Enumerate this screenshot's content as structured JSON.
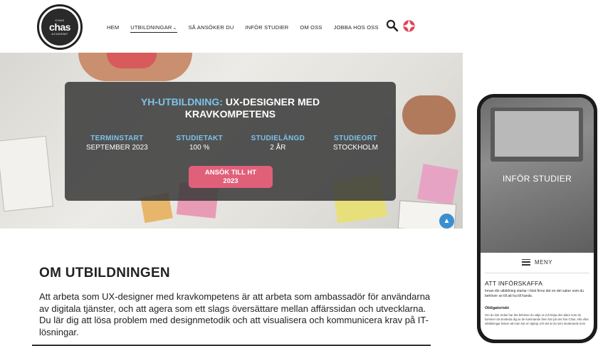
{
  "header": {
    "logo": {
      "small_top": "CHAS",
      "name": "chas",
      "small_bottom": "ACADEMY"
    },
    "nav": [
      {
        "label": "HEM"
      },
      {
        "label": "UTBILDNINGAR",
        "active": true
      },
      {
        "label": "SÅ ANSÖKER DU"
      },
      {
        "label": "INFÖR STUDIER"
      },
      {
        "label": "OM OSS"
      },
      {
        "label": "JOBBA HOS OSS"
      }
    ],
    "search_icon": "search-icon",
    "help_icon": "lifebuoy-icon"
  },
  "hero": {
    "title_prefix": "YH-UTBILDNING:",
    "title_rest_line1": "UX-DESIGNER MED",
    "title_line2": "KRAVKOMPETENS",
    "facts": [
      {
        "label": "TERMINSTART",
        "value": "SEPTEMBER 2023"
      },
      {
        "label": "STUDIETAKT",
        "value": "100 %"
      },
      {
        "label": "STUDIELÄNGD",
        "value": "2 ÅR"
      },
      {
        "label": "STUDIEORT",
        "value": "STOCKHOLM"
      }
    ],
    "apply_line1": "ANSÖK TILL HT",
    "apply_line2": "2023",
    "scroll_top_icon": "arrow-up-icon"
  },
  "content": {
    "heading": "OM UTBILDNINGEN",
    "body": "Att arbeta som UX-designer med kravkompetens är att arbeta som ambassadör för användarna av digitala tjänster, och att agera som ett slags översättare mellan affärssidan och utvecklarna. Du lär dig att lösa problem med designmetodik och att visualisera och kommunicera krav på IT-lösningar."
  },
  "phone": {
    "hero_title": "INFÖR STUDIER",
    "menu_label": "MENY",
    "heading": "ATT INFÖRSKAFFA",
    "intro": "Innan din utbildning startar i höst finns det en del saker som du behöver se till att ha till hands.",
    "subheading": "Obligatoriskt",
    "body": "Om du inte redan har det behöver du välja ut och köpa den dator som du kommer att använda dig av de kommande åren här på oss hos Chas. Alla våra utbildningar kräver att man har en laptop och det är du som studerande som"
  },
  "colors": {
    "accent_blue": "#7cc4e8",
    "apply_pink": "#e0607a",
    "card_bg": "#3c3c3c",
    "scroll_blue": "#3b8fd0"
  }
}
